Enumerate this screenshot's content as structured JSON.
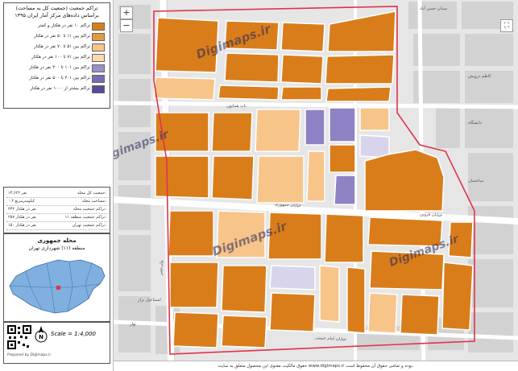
{
  "legend": {
    "title_line1": "تراکم جمعیت (جمعیت کل به مساحت)",
    "title_line2": "براساس داده‌های مرکز آمار ایران ۱۳۹۵",
    "classes": [
      {
        "label": "تراکم ۱۰ نفر در هکتار و کمتر",
        "color": "#d97d1b"
      },
      {
        "label": "تراکم بین ۱۱ تا ۵۰ نفر در هکتار",
        "color": "#e69a3f"
      },
      {
        "label": "تراکم بین ۵۱ تا ۷۰ نفر در هکتار",
        "color": "#f7c58a"
      },
      {
        "label": "تراکم بین ۷۱ تا ۱۰۰ نفر در هکتار",
        "color": "#fbd9ae"
      },
      {
        "label": "تراکم بین ۱۰۱ تا ۲۰۰ نفر در هکتار",
        "color": "#9b8fc9"
      },
      {
        "label": "تراکم بین ۲۰۱ تا ۵۰۰ نفر در هکتار",
        "color": "#7a69b4"
      },
      {
        "label": "تراکم بیشتر از ۱۰۰۰ نفر در هکتار",
        "color": "#5a4a9a"
      }
    ],
    "stats": [
      {
        "key": "جمعیت کل محله:",
        "value": "۱۳,۶۲۲ نفر"
      },
      {
        "key": "مساحت محله:",
        "value": "۰.۲ کیلومترمربع"
      },
      {
        "key": "تراکم جمعیت محله:",
        "value": "۲۳۲ نفر در هکتار"
      },
      {
        "key": "تراکم جمعیت منطقه ۱۱:",
        "value": "۲۵۷ نفر در هکتار"
      },
      {
        "key": "تراکم جمعیت تهران:",
        "value": "۱۵۰ نفر در هکتار"
      }
    ],
    "area_name": "محله جمهوری",
    "area_district": "منطقه (۱۱) شهرداری تهران",
    "scale": "Scale = 1:4,000",
    "credit": "Prepared by Digimaps.ir"
  },
  "map": {
    "watermark": "Digimaps.ir",
    "road_labels": [
      "خیابان جمهوری",
      "خیابان قزوین",
      "باب همایون",
      "ولی‌عصر",
      "میدان حسن آباد",
      "کاظم درویش",
      "خیابان امام خمینی",
      "اسماعیل بزاز",
      "دانشگاه",
      "ساختمان",
      "بهار"
    ],
    "controls": {
      "zoom_in": "+",
      "zoom_out": "−"
    }
  },
  "footer": {
    "text": "حقوق مالکیت معنوی این محصول متعلق به سایت www.digimaps.ir بوده و تمامی حقوق آن محفوظ است."
  },
  "colors": {
    "high": "#d97d1b",
    "mid": "#f7c58a",
    "purple": "#8f82c4",
    "lavender": "#d8d4ec",
    "boundary": "#e0334a",
    "grey_block": "#c9c9c9"
  }
}
